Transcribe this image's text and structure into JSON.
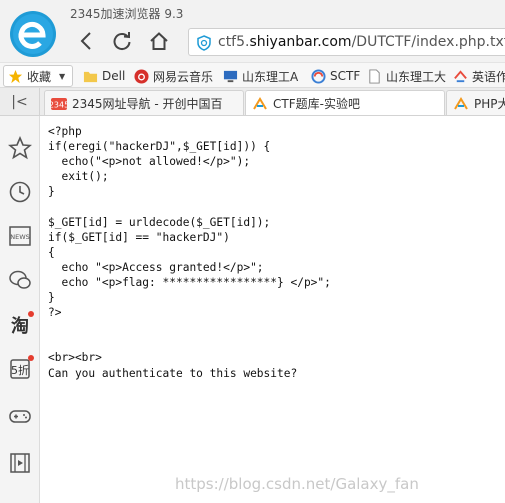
{
  "browser": {
    "title": "2345加速浏览器 9.3",
    "address": {
      "prefix": "ctf5.",
      "domain": "shiyanbar.com",
      "path": "/DUTCTF/index.php.txt"
    }
  },
  "bookmarks": {
    "favorites_label": "收藏",
    "items": [
      {
        "label": "Dell",
        "icon": "folder-icon"
      },
      {
        "label": "网易云音乐",
        "icon": "netease-music-icon"
      },
      {
        "label": "山东理工A",
        "icon": "monitor-icon"
      },
      {
        "label": "SCTF",
        "icon": "swirl-icon"
      },
      {
        "label": "山东理工大",
        "icon": "page-icon"
      },
      {
        "label": "英语作",
        "icon": "bookmark-icon"
      }
    ]
  },
  "tabs": [
    {
      "label": "2345网址导航 - 开创中国百",
      "icon": "2345-icon"
    },
    {
      "label": "CTF题库-实验吧",
      "icon": "shiyanbar-icon"
    },
    {
      "label": "PHP大",
      "icon": "shiyanbar-icon"
    }
  ],
  "page": {
    "lines": [
      "<?php",
      "if(eregi(\"hackerDJ\",$_GET[id])) {",
      "  echo(\"<p>not allowed!</p>\");",
      "  exit();",
      "}",
      "",
      "$_GET[id] = urldecode($_GET[id]);",
      "if($_GET[id] == \"hackerDJ\")",
      "{",
      "  echo \"<p>Access granted!</p>\";",
      "  echo \"<p>flag: *****************} </p>\";",
      "}",
      "?>",
      "",
      "",
      "<br><br>",
      "Can you authenticate to this website?"
    ],
    "watermark": "https://blog.csdn.net/Galaxy_fan"
  },
  "colors": {
    "accent": "#1f9bd6",
    "chrome": "#f2f2f2"
  }
}
